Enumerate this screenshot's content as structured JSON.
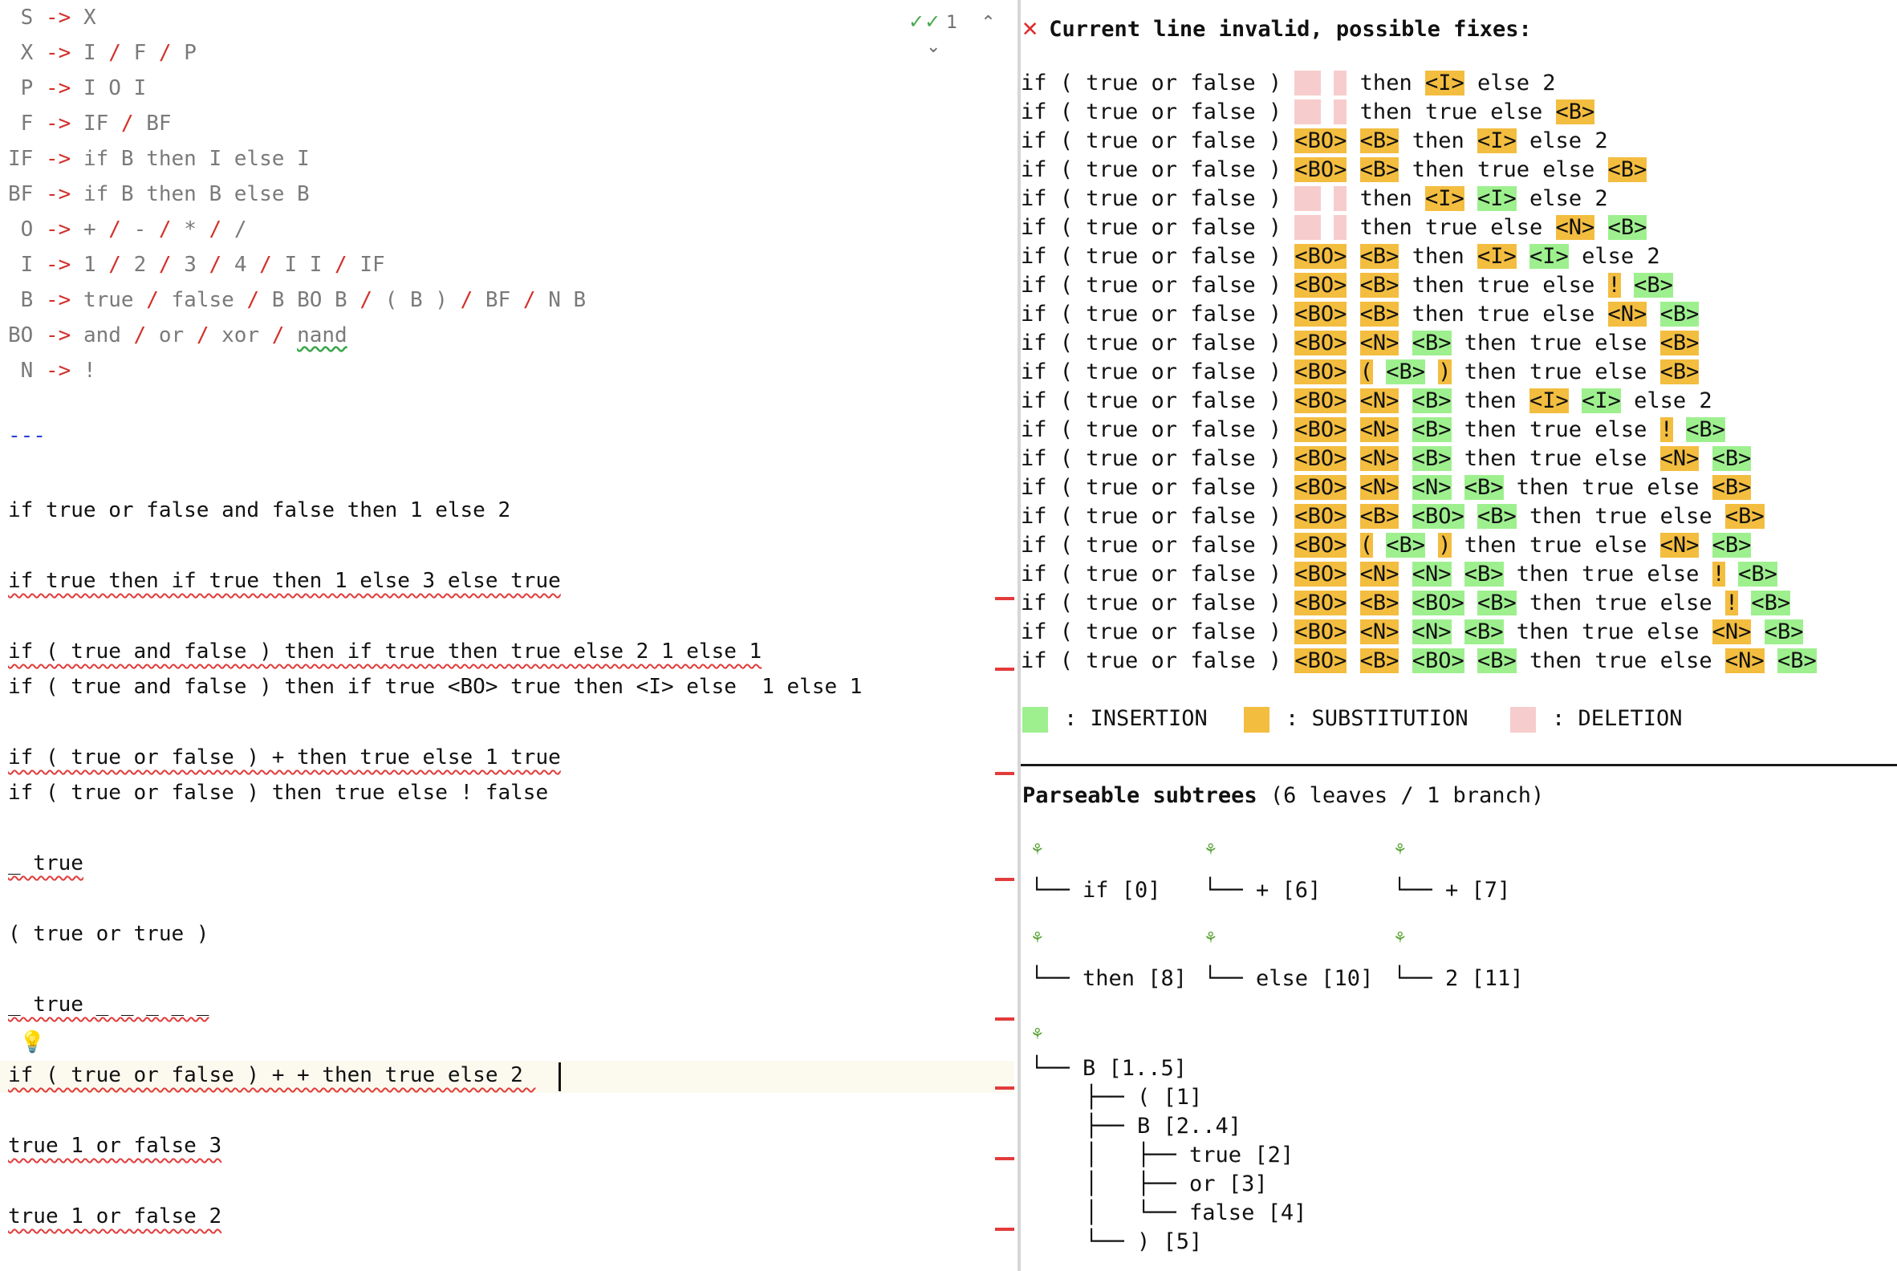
{
  "editor": {
    "grammar": [
      {
        "lhs": " S",
        "rhs": [
          "X"
        ]
      },
      {
        "lhs": " X",
        "rhs": [
          "I",
          "F",
          "P"
        ]
      },
      {
        "lhs": " P",
        "rhs": [
          "I O I"
        ]
      },
      {
        "lhs": " F",
        "rhs": [
          "IF",
          "BF"
        ]
      },
      {
        "lhs": "IF",
        "rhs": [
          "if B then I else I"
        ]
      },
      {
        "lhs": "BF",
        "rhs": [
          "if B then B else B"
        ]
      },
      {
        "lhs": " O",
        "rhs": [
          "+",
          "-",
          "*",
          "/"
        ]
      },
      {
        "lhs": " I",
        "rhs": [
          "1",
          "2",
          "3",
          "4",
          "I I",
          "IF"
        ]
      },
      {
        "lhs": " B",
        "rhs": [
          "true",
          "false",
          "B BO B",
          "( B )",
          "BF",
          "N B"
        ]
      },
      {
        "lhs": "BO",
        "rhs": [
          "and",
          "or",
          "xor",
          "nand"
        ]
      },
      {
        "lhs": " N",
        "rhs": [
          "!"
        ]
      }
    ],
    "arrow": "->",
    "separator": "---",
    "lines": [
      {
        "text": "if true or false and false then 1 else 2",
        "error": false
      },
      {
        "text": "if true then if true then 1 else 3 else true",
        "error": true
      },
      {
        "text": "if ( true and false ) then if true then true else 2 1 else 1",
        "error": true
      },
      {
        "text": "if ( true and false ) then if true <BO> true then <I> else  1 else 1",
        "error": false
      },
      {
        "text": "if ( true or false ) + then true else 1 true",
        "error": true
      },
      {
        "text": "if ( true or false ) then true else ! false",
        "error": false
      },
      {
        "text": "_ true",
        "error": true
      },
      {
        "text": "( true or true )",
        "error": false
      },
      {
        "text": "_ true _ _ _ _ _",
        "error": true
      },
      {
        "text": "if ( true or false ) + + then true else 2 ",
        "error": true
      },
      {
        "text": "true 1 or false 3",
        "error": true
      },
      {
        "text": "true 1 or false 2",
        "error": true
      }
    ],
    "inspection_count": "1",
    "inspection_icon": "double-check-icon",
    "bulb_icon": "lightbulb-icon"
  },
  "fixes": {
    "header": "Current line invalid, possible fixes:",
    "error_icon": "x-icon",
    "prefix": "if ( true or false )",
    "rows": [
      [
        [
          "del",
          "  "
        ],
        [
          "p",
          " "
        ],
        [
          "del",
          " "
        ],
        [
          "p",
          " then "
        ],
        [
          "sub",
          "<I>"
        ],
        [
          "p",
          " else 2"
        ]
      ],
      [
        [
          "del",
          "  "
        ],
        [
          "p",
          " "
        ],
        [
          "del",
          " "
        ],
        [
          "p",
          " then true else "
        ],
        [
          "sub",
          "<B>"
        ]
      ],
      [
        [
          "sub",
          "<BO>"
        ],
        [
          "p",
          " "
        ],
        [
          "sub",
          "<B>"
        ],
        [
          "p",
          " then "
        ],
        [
          "sub",
          "<I>"
        ],
        [
          "p",
          " else 2"
        ]
      ],
      [
        [
          "sub",
          "<BO>"
        ],
        [
          "p",
          " "
        ],
        [
          "sub",
          "<B>"
        ],
        [
          "p",
          " then true else "
        ],
        [
          "sub",
          "<B>"
        ]
      ],
      [
        [
          "del",
          "  "
        ],
        [
          "p",
          " "
        ],
        [
          "del",
          " "
        ],
        [
          "p",
          " then "
        ],
        [
          "sub",
          "<I>"
        ],
        [
          "p",
          " "
        ],
        [
          "ins",
          "<I>"
        ],
        [
          "p",
          " else 2"
        ]
      ],
      [
        [
          "del",
          "  "
        ],
        [
          "p",
          " "
        ],
        [
          "del",
          " "
        ],
        [
          "p",
          " then true else "
        ],
        [
          "sub",
          "<N>"
        ],
        [
          "p",
          " "
        ],
        [
          "ins",
          "<B>"
        ]
      ],
      [
        [
          "sub",
          "<BO>"
        ],
        [
          "p",
          " "
        ],
        [
          "sub",
          "<B>"
        ],
        [
          "p",
          " then "
        ],
        [
          "sub",
          "<I>"
        ],
        [
          "p",
          " "
        ],
        [
          "ins",
          "<I>"
        ],
        [
          "p",
          " else 2"
        ]
      ],
      [
        [
          "sub",
          "<BO>"
        ],
        [
          "p",
          " "
        ],
        [
          "sub",
          "<B>"
        ],
        [
          "p",
          " then true else "
        ],
        [
          "sub",
          "!"
        ],
        [
          "p",
          " "
        ],
        [
          "ins",
          "<B>"
        ]
      ],
      [
        [
          "sub",
          "<BO>"
        ],
        [
          "p",
          " "
        ],
        [
          "sub",
          "<B>"
        ],
        [
          "p",
          " then true else "
        ],
        [
          "sub",
          "<N>"
        ],
        [
          "p",
          " "
        ],
        [
          "ins",
          "<B>"
        ]
      ],
      [
        [
          "sub",
          "<BO>"
        ],
        [
          "p",
          " "
        ],
        [
          "sub",
          "<N>"
        ],
        [
          "p",
          " "
        ],
        [
          "ins",
          "<B>"
        ],
        [
          "p",
          " then true else "
        ],
        [
          "sub",
          "<B>"
        ]
      ],
      [
        [
          "sub",
          "<BO>"
        ],
        [
          "p",
          " "
        ],
        [
          "sub",
          "("
        ],
        [
          "p",
          " "
        ],
        [
          "ins",
          "<B>"
        ],
        [
          "p",
          " "
        ],
        [
          "sub",
          ")"
        ],
        [
          "p",
          " then true else "
        ],
        [
          "sub",
          "<B>"
        ]
      ],
      [
        [
          "sub",
          "<BO>"
        ],
        [
          "p",
          " "
        ],
        [
          "sub",
          "<N>"
        ],
        [
          "p",
          " "
        ],
        [
          "ins",
          "<B>"
        ],
        [
          "p",
          " then "
        ],
        [
          "sub",
          "<I>"
        ],
        [
          "p",
          " "
        ],
        [
          "ins",
          "<I>"
        ],
        [
          "p",
          " else 2"
        ]
      ],
      [
        [
          "sub",
          "<BO>"
        ],
        [
          "p",
          " "
        ],
        [
          "sub",
          "<N>"
        ],
        [
          "p",
          " "
        ],
        [
          "ins",
          "<B>"
        ],
        [
          "p",
          " then true else "
        ],
        [
          "sub",
          "!"
        ],
        [
          "p",
          " "
        ],
        [
          "ins",
          "<B>"
        ]
      ],
      [
        [
          "sub",
          "<BO>"
        ],
        [
          "p",
          " "
        ],
        [
          "sub",
          "<N>"
        ],
        [
          "p",
          " "
        ],
        [
          "ins",
          "<B>"
        ],
        [
          "p",
          " then true else "
        ],
        [
          "sub",
          "<N>"
        ],
        [
          "p",
          " "
        ],
        [
          "ins",
          "<B>"
        ]
      ],
      [
        [
          "sub",
          "<BO>"
        ],
        [
          "p",
          " "
        ],
        [
          "sub",
          "<N>"
        ],
        [
          "p",
          " "
        ],
        [
          "ins",
          "<N>"
        ],
        [
          "p",
          " "
        ],
        [
          "ins",
          "<B>"
        ],
        [
          "p",
          " then true else "
        ],
        [
          "sub",
          "<B>"
        ]
      ],
      [
        [
          "sub",
          "<BO>"
        ],
        [
          "p",
          " "
        ],
        [
          "sub",
          "<B>"
        ],
        [
          "p",
          " "
        ],
        [
          "ins",
          "<BO>"
        ],
        [
          "p",
          " "
        ],
        [
          "ins",
          "<B>"
        ],
        [
          "p",
          " then true else "
        ],
        [
          "sub",
          "<B>"
        ]
      ],
      [
        [
          "sub",
          "<BO>"
        ],
        [
          "p",
          " "
        ],
        [
          "sub",
          "("
        ],
        [
          "p",
          " "
        ],
        [
          "ins",
          "<B>"
        ],
        [
          "p",
          " "
        ],
        [
          "sub",
          ")"
        ],
        [
          "p",
          " then true else "
        ],
        [
          "sub",
          "<N>"
        ],
        [
          "p",
          " "
        ],
        [
          "ins",
          "<B>"
        ]
      ],
      [
        [
          "sub",
          "<BO>"
        ],
        [
          "p",
          " "
        ],
        [
          "sub",
          "<N>"
        ],
        [
          "p",
          " "
        ],
        [
          "ins",
          "<N>"
        ],
        [
          "p",
          " "
        ],
        [
          "ins",
          "<B>"
        ],
        [
          "p",
          " then true else "
        ],
        [
          "sub",
          "!"
        ],
        [
          "p",
          " "
        ],
        [
          "ins",
          "<B>"
        ]
      ],
      [
        [
          "sub",
          "<BO>"
        ],
        [
          "p",
          " "
        ],
        [
          "sub",
          "<B>"
        ],
        [
          "p",
          " "
        ],
        [
          "ins",
          "<BO>"
        ],
        [
          "p",
          " "
        ],
        [
          "ins",
          "<B>"
        ],
        [
          "p",
          " then true else "
        ],
        [
          "sub",
          "!"
        ],
        [
          "p",
          " "
        ],
        [
          "ins",
          "<B>"
        ]
      ],
      [
        [
          "sub",
          "<BO>"
        ],
        [
          "p",
          " "
        ],
        [
          "sub",
          "<N>"
        ],
        [
          "p",
          " "
        ],
        [
          "ins",
          "<N>"
        ],
        [
          "p",
          " "
        ],
        [
          "ins",
          "<B>"
        ],
        [
          "p",
          " then true else "
        ],
        [
          "sub",
          "<N>"
        ],
        [
          "p",
          " "
        ],
        [
          "ins",
          "<B>"
        ]
      ],
      [
        [
          "sub",
          "<BO>"
        ],
        [
          "p",
          " "
        ],
        [
          "sub",
          "<B>"
        ],
        [
          "p",
          " "
        ],
        [
          "ins",
          "<BO>"
        ],
        [
          "p",
          " "
        ],
        [
          "ins",
          "<B>"
        ],
        [
          "p",
          " then true else "
        ],
        [
          "sub",
          "<N>"
        ],
        [
          "p",
          " "
        ],
        [
          "ins",
          "<B>"
        ]
      ]
    ],
    "legend": [
      {
        "label": ": INSERTION",
        "color": "#9ef08f"
      },
      {
        "label": ": SUBSTITUTION",
        "color": "#f3bd3f"
      },
      {
        "label": ": DELETION",
        "color": "#f7cccc"
      }
    ]
  },
  "subtrees": {
    "title": "Parseable subtrees",
    "summary": "(6 leaves / 1 branch)",
    "leaf_icon": "sprout-icon",
    "leaves": [
      "if [0]",
      "+ [6]",
      "+ [7]",
      "then [8]",
      "else [10]",
      "2 [11]"
    ],
    "branch": {
      "label": "B [1..5]",
      "children": [
        {
          "label": "( [1]"
        },
        {
          "label": "B [2..4]",
          "children": [
            "true [2]",
            "or [3]",
            "false [4]"
          ]
        },
        {
          "label": ") [5]"
        }
      ]
    }
  },
  "colors": {
    "insertion": "#9ef08f",
    "substitution": "#f3bd3f",
    "deletion": "#f7cccc",
    "error": "#e23b3b",
    "keyword_arrow": "#d2302a"
  }
}
